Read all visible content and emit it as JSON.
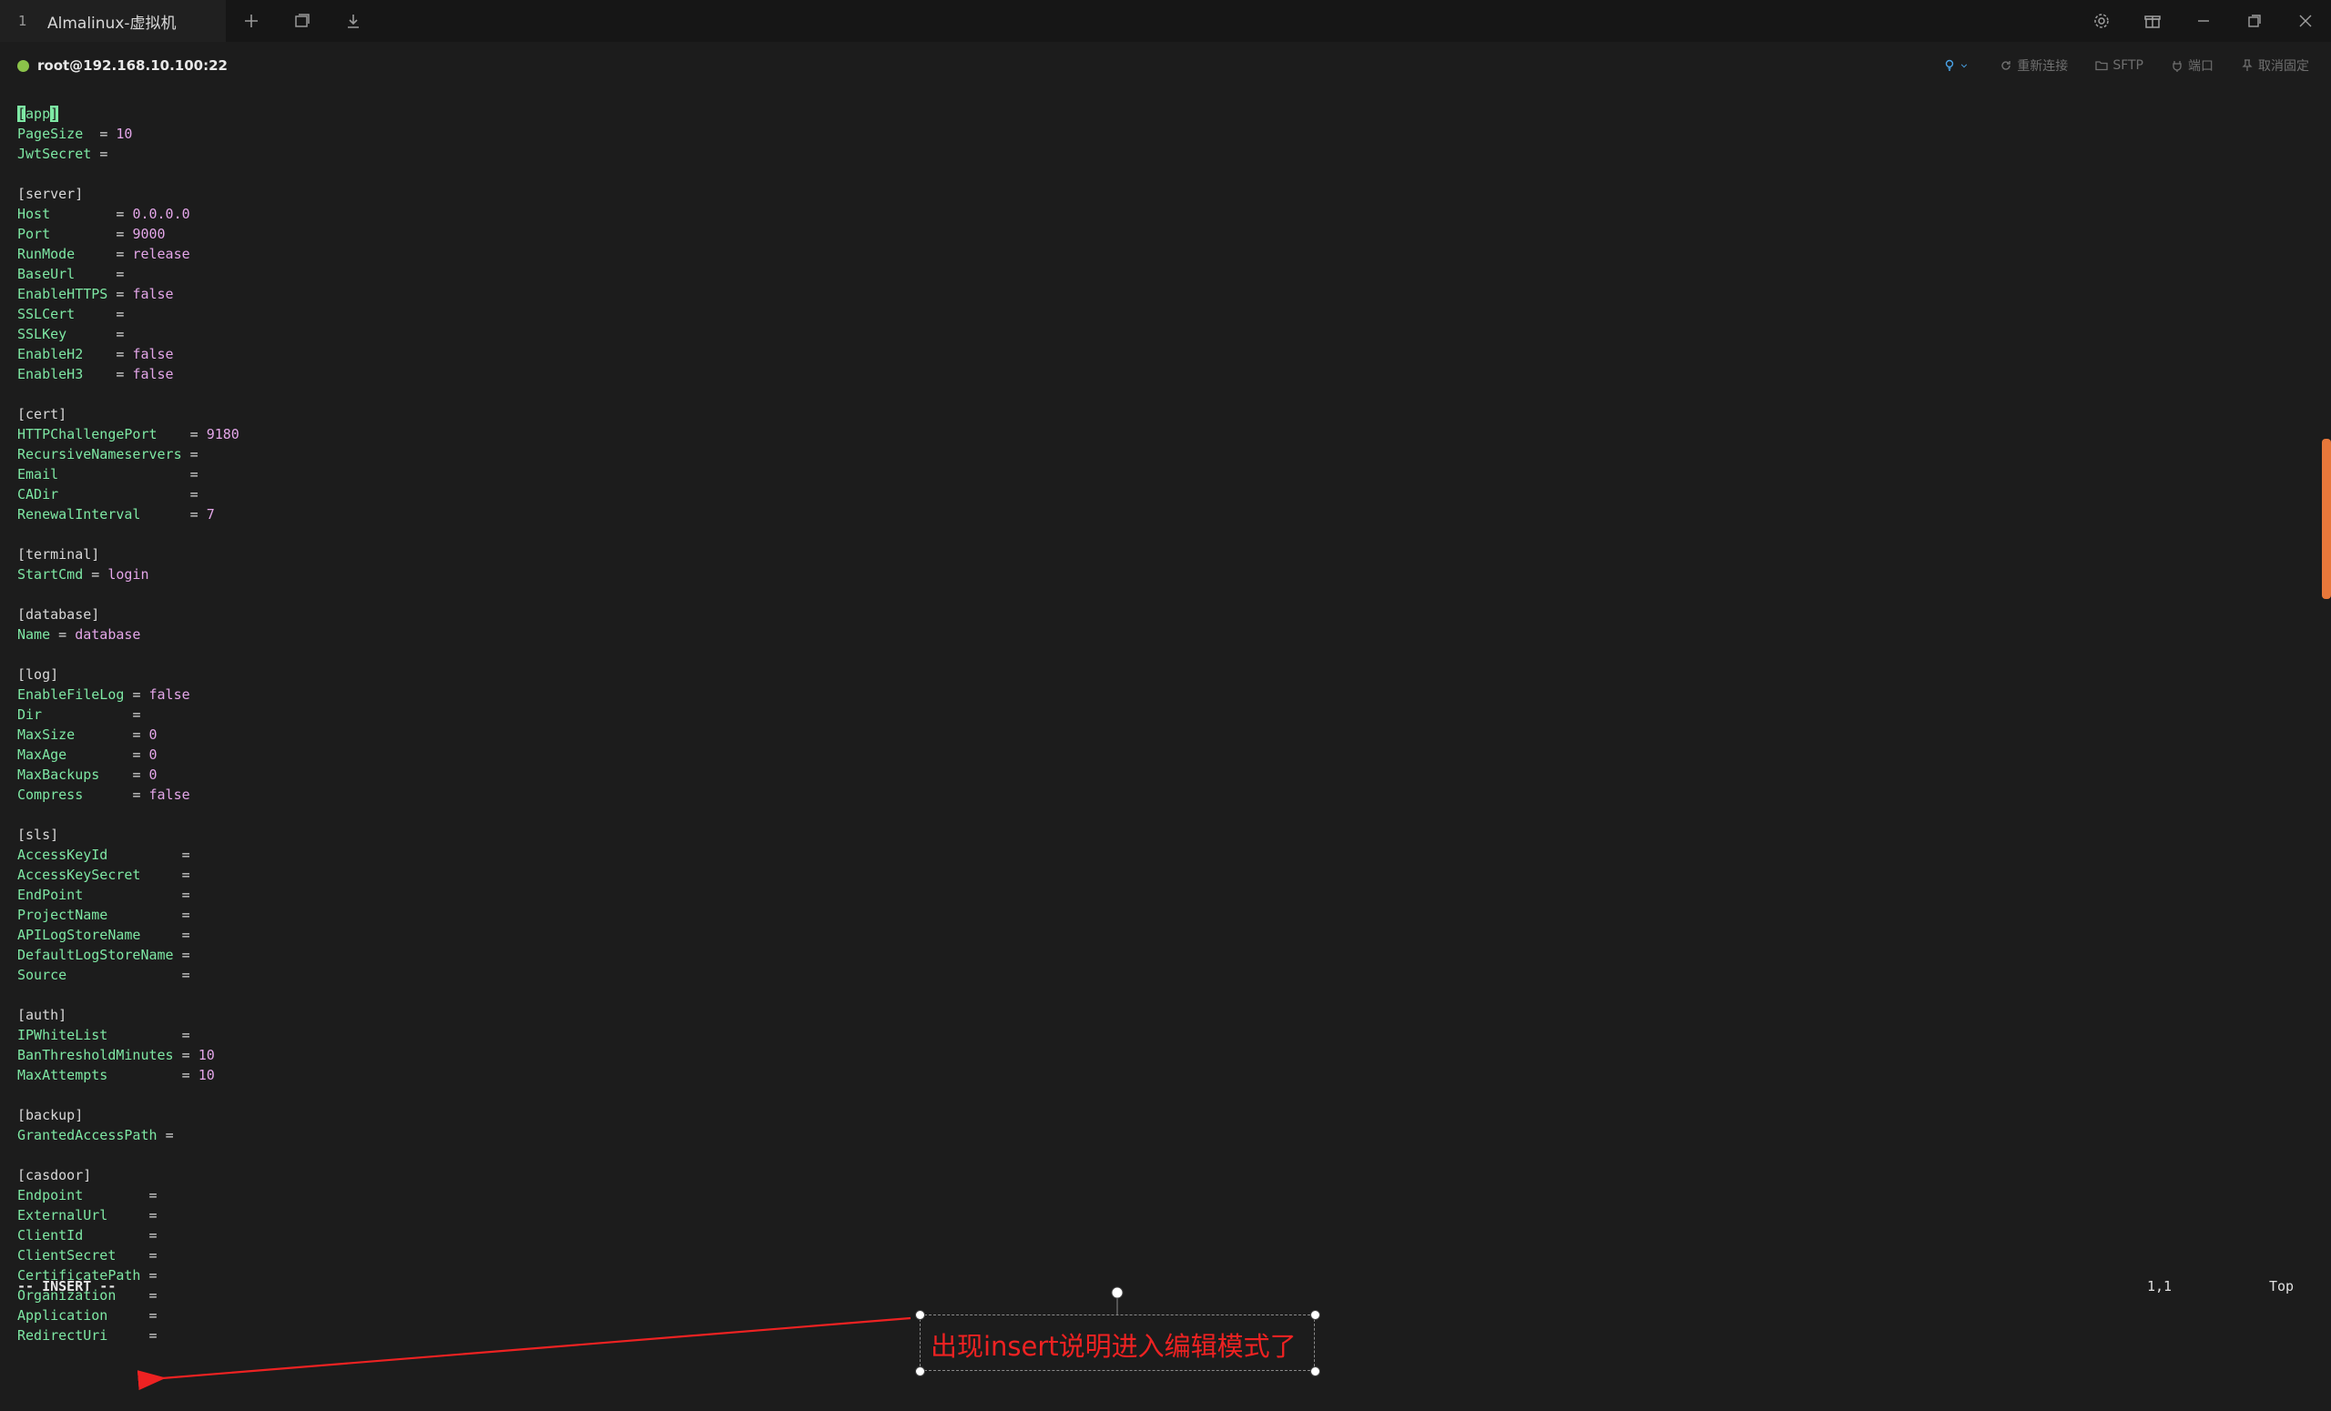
{
  "tabs": [
    {
      "index": "1",
      "title": "Almalinux-虚拟机"
    }
  ],
  "session": {
    "host": "root@192.168.10.100:22",
    "actions": [
      {
        "label": "重新连接",
        "icon": "refresh-icon"
      },
      {
        "label": "SFTP",
        "icon": "folder-icon"
      },
      {
        "label": "端口",
        "icon": "plug-icon"
      },
      {
        "label": "取消固定",
        "icon": "pin-icon"
      }
    ]
  },
  "terminal": {
    "lines": [
      {
        "type": "section",
        "text": "[app]"
      },
      {
        "type": "kv",
        "key": "PageSize",
        "pad": "  ",
        "value": "10"
      },
      {
        "type": "kv",
        "key": "JwtSecret",
        "pad": " ",
        "value": ""
      },
      {
        "type": "blank"
      },
      {
        "type": "section",
        "text": "[server]"
      },
      {
        "type": "kv",
        "key": "Host",
        "pad": "        ",
        "value": "0.0.0.0"
      },
      {
        "type": "kv",
        "key": "Port",
        "pad": "        ",
        "value": "9000"
      },
      {
        "type": "kv",
        "key": "RunMode",
        "pad": "     ",
        "value": "release"
      },
      {
        "type": "kv",
        "key": "BaseUrl",
        "pad": "     ",
        "value": ""
      },
      {
        "type": "kv",
        "key": "EnableHTTPS",
        "pad": " ",
        "value": "false"
      },
      {
        "type": "kv",
        "key": "SSLCert",
        "pad": "     ",
        "value": ""
      },
      {
        "type": "kv",
        "key": "SSLKey",
        "pad": "      ",
        "value": ""
      },
      {
        "type": "kv",
        "key": "EnableH2",
        "pad": "    ",
        "value": "false"
      },
      {
        "type": "kv",
        "key": "EnableH3",
        "pad": "    ",
        "value": "false"
      },
      {
        "type": "blank"
      },
      {
        "type": "section",
        "text": "[cert]"
      },
      {
        "type": "kv",
        "key": "HTTPChallengePort",
        "pad": "    ",
        "value": "9180"
      },
      {
        "type": "kv",
        "key": "RecursiveNameservers",
        "pad": " ",
        "value": ""
      },
      {
        "type": "kv",
        "key": "Email",
        "pad": "                ",
        "value": ""
      },
      {
        "type": "kv",
        "key": "CADir",
        "pad": "                ",
        "value": ""
      },
      {
        "type": "kv",
        "key": "RenewalInterval",
        "pad": "      ",
        "value": "7"
      },
      {
        "type": "blank"
      },
      {
        "type": "section",
        "text": "[terminal]"
      },
      {
        "type": "kv",
        "key": "StartCmd",
        "pad": " ",
        "value": "login"
      },
      {
        "type": "blank"
      },
      {
        "type": "section",
        "text": "[database]"
      },
      {
        "type": "kv",
        "key": "Name",
        "pad": " ",
        "value": "database"
      },
      {
        "type": "blank"
      },
      {
        "type": "section",
        "text": "[log]"
      },
      {
        "type": "kv",
        "key": "EnableFileLog",
        "pad": " ",
        "value": "false"
      },
      {
        "type": "kv",
        "key": "Dir",
        "pad": "           ",
        "value": ""
      },
      {
        "type": "kv",
        "key": "MaxSize",
        "pad": "       ",
        "value": "0"
      },
      {
        "type": "kv",
        "key": "MaxAge",
        "pad": "        ",
        "value": "0"
      },
      {
        "type": "kv",
        "key": "MaxBackups",
        "pad": "    ",
        "value": "0"
      },
      {
        "type": "kv",
        "key": "Compress",
        "pad": "      ",
        "value": "false"
      },
      {
        "type": "blank"
      },
      {
        "type": "section",
        "text": "[sls]"
      },
      {
        "type": "kv",
        "key": "AccessKeyId",
        "pad": "         ",
        "value": ""
      },
      {
        "type": "kv",
        "key": "AccessKeySecret",
        "pad": "     ",
        "value": ""
      },
      {
        "type": "kv",
        "key": "EndPoint",
        "pad": "            ",
        "value": ""
      },
      {
        "type": "kv",
        "key": "ProjectName",
        "pad": "         ",
        "value": ""
      },
      {
        "type": "kv",
        "key": "APILogStoreName",
        "pad": "     ",
        "value": ""
      },
      {
        "type": "kv",
        "key": "DefaultLogStoreName",
        "pad": " ",
        "value": ""
      },
      {
        "type": "kv",
        "key": "Source",
        "pad": "              ",
        "value": ""
      },
      {
        "type": "blank"
      },
      {
        "type": "section",
        "text": "[auth]"
      },
      {
        "type": "kv",
        "key": "IPWhiteList",
        "pad": "         ",
        "value": ""
      },
      {
        "type": "kv",
        "key": "BanThresholdMinutes",
        "pad": " ",
        "value": "10"
      },
      {
        "type": "kv",
        "key": "MaxAttempts",
        "pad": "         ",
        "value": "10"
      },
      {
        "type": "blank"
      },
      {
        "type": "section",
        "text": "[backup]"
      },
      {
        "type": "kv",
        "key": "GrantedAccessPath",
        "pad": " ",
        "value": ""
      },
      {
        "type": "blank"
      },
      {
        "type": "section",
        "text": "[casdoor]"
      },
      {
        "type": "kv",
        "key": "Endpoint",
        "pad": "        ",
        "value": ""
      },
      {
        "type": "kv",
        "key": "ExternalUrl",
        "pad": "     ",
        "value": ""
      },
      {
        "type": "kv",
        "key": "ClientId",
        "pad": "        ",
        "value": ""
      },
      {
        "type": "kv",
        "key": "ClientSecret",
        "pad": "    ",
        "value": ""
      },
      {
        "type": "kv",
        "key": "CertificatePath",
        "pad": " ",
        "value": ""
      },
      {
        "type": "kv",
        "key": "Organization",
        "pad": "    ",
        "value": ""
      },
      {
        "type": "kv",
        "key": "Application",
        "pad": "     ",
        "value": ""
      },
      {
        "type": "kv",
        "key": "RedirectUri",
        "pad": "     ",
        "value": ""
      }
    ],
    "mode": "-- INSERT --",
    "cursor_pos": "1,1",
    "scroll_pos": "Top"
  },
  "annotation": {
    "text": "出现insert说明进入编辑模式了",
    "color": "#ee2222"
  },
  "colors": {
    "key": "#7ee8a4",
    "value": "#e3a6e8",
    "connected": "#8bc34a",
    "scroll_thumb": "#e8773a"
  }
}
